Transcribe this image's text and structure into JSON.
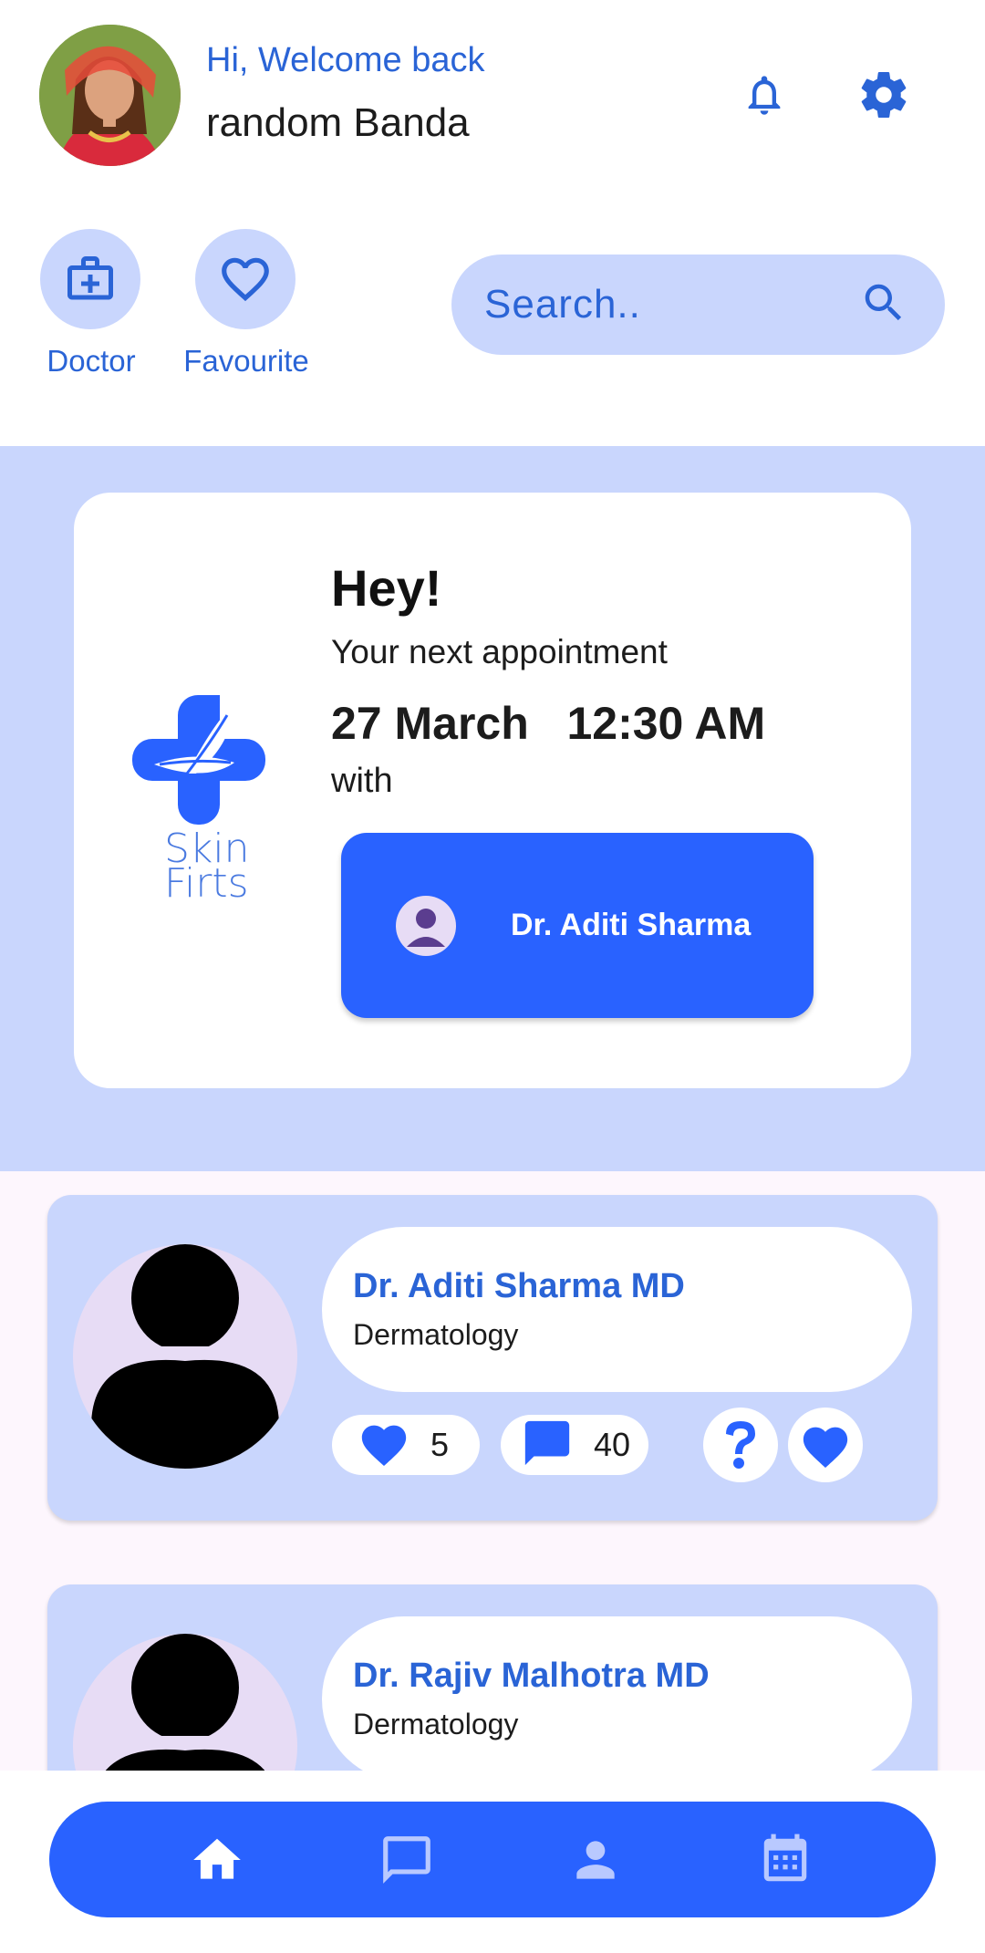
{
  "header": {
    "greeting": "Hi, Welcome back",
    "username": "random Banda",
    "icons": [
      "bell-icon",
      "gear-icon"
    ]
  },
  "quick_actions": [
    {
      "label": "Doctor",
      "icon": "medical-bag-icon"
    },
    {
      "label": "Favourite",
      "icon": "heart-outline-icon"
    }
  ],
  "search": {
    "placeholder": "Search.."
  },
  "appointment": {
    "title": "Hey!",
    "subtitle": "Your next appointment",
    "date": "27 March",
    "time": "12:30 AM",
    "with_label": "with",
    "doctor": "Dr. Aditi Sharma",
    "logo_line1": "Skin",
    "logo_line2": "Firts"
  },
  "doctors": [
    {
      "name": "Dr. Aditi Sharma MD",
      "specialty": "Dermatology",
      "likes": "5",
      "comments": "40"
    },
    {
      "name": "Dr. Rajiv Malhotra MD",
      "specialty": "Dermatology"
    }
  ],
  "nav": [
    "home-icon",
    "chat-icon",
    "person-icon",
    "calendar-icon"
  ],
  "colors": {
    "primary": "#2962ff",
    "accent_text": "#2a64d6",
    "light": "#c9d6fd"
  }
}
